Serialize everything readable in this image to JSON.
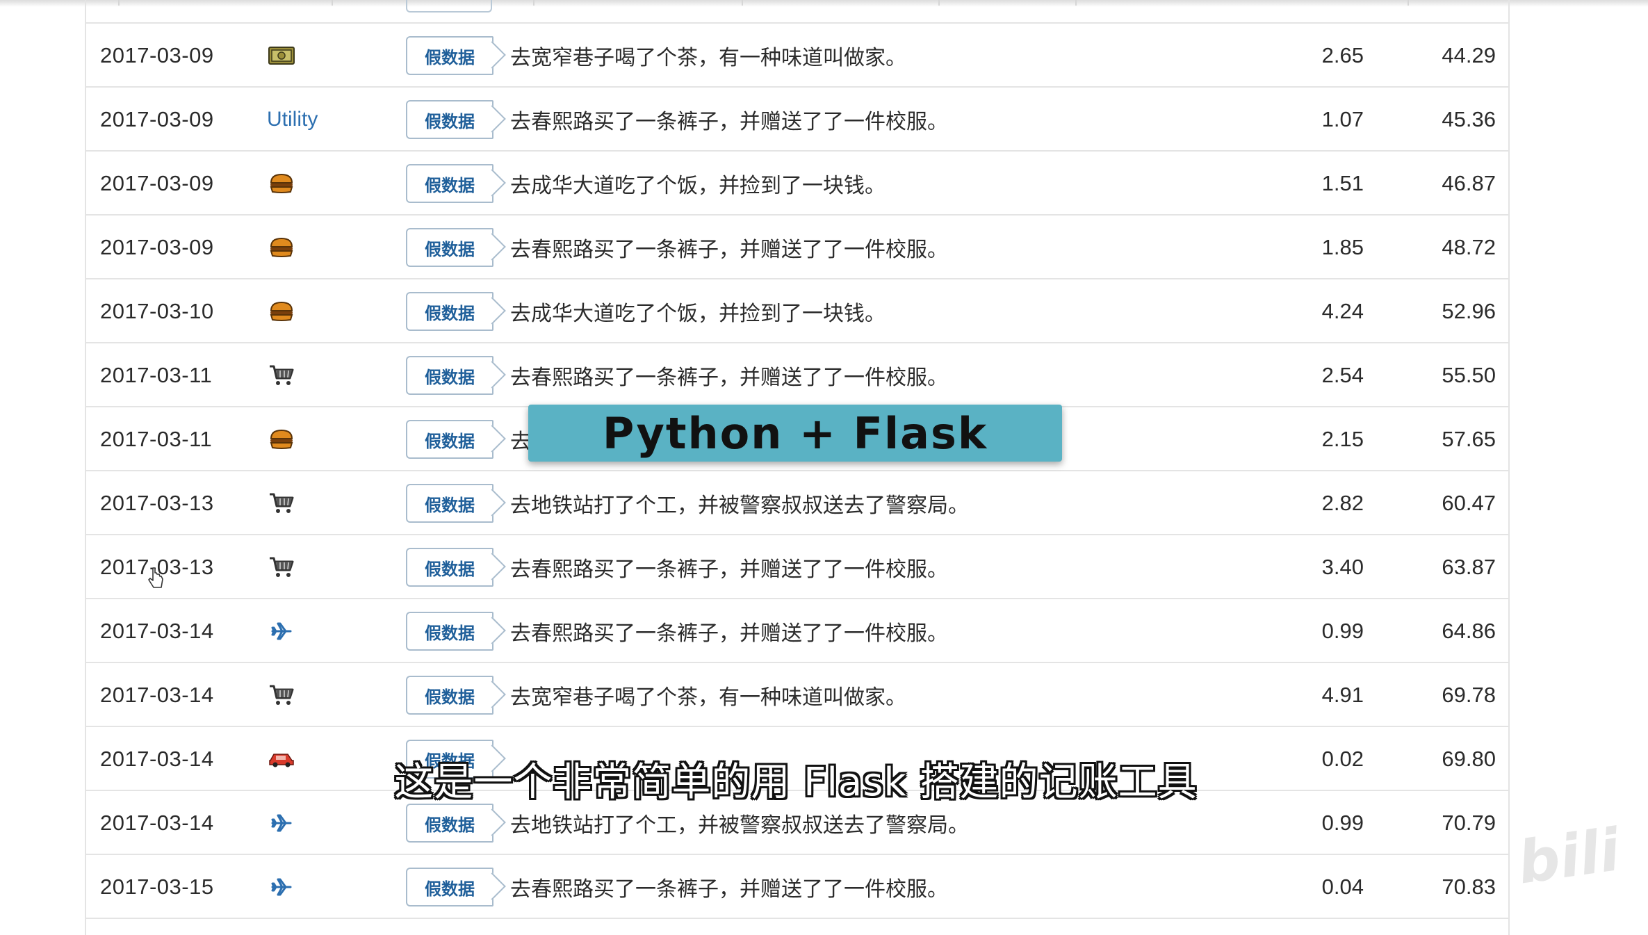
{
  "tag_label": "假数据",
  "rows": [
    {
      "date": "2017-03-09",
      "category": {
        "type": "icon",
        "icon": "money-icon"
      },
      "desc": "去宽窄巷子喝了个茶，有一种味道叫做家。",
      "amount": "2.65",
      "balance": "44.29"
    },
    {
      "date": "2017-03-09",
      "category": {
        "type": "text",
        "text": "Utility"
      },
      "desc": "去春熙路买了一条裤子，并赠送了了一件校服。",
      "amount": "1.07",
      "balance": "45.36"
    },
    {
      "date": "2017-03-09",
      "category": {
        "type": "icon",
        "icon": "burger-icon"
      },
      "desc": "去成华大道吃了个饭，并捡到了一块钱。",
      "amount": "1.51",
      "balance": "46.87"
    },
    {
      "date": "2017-03-09",
      "category": {
        "type": "icon",
        "icon": "burger-icon"
      },
      "desc": "去春熙路买了一条裤子，并赠送了了一件校服。",
      "amount": "1.85",
      "balance": "48.72"
    },
    {
      "date": "2017-03-10",
      "category": {
        "type": "icon",
        "icon": "burger-icon"
      },
      "desc": "去成华大道吃了个饭，并捡到了一块钱。",
      "amount": "4.24",
      "balance": "52.96"
    },
    {
      "date": "2017-03-11",
      "category": {
        "type": "icon",
        "icon": "shopping-cart-icon"
      },
      "desc": "去春熙路买了一条裤子，并赠送了了一件校服。",
      "amount": "2.54",
      "balance": "55.50"
    },
    {
      "date": "2017-03-11",
      "category": {
        "type": "icon",
        "icon": "burger-icon"
      },
      "desc": "去",
      "amount": "2.15",
      "balance": "57.65"
    },
    {
      "date": "2017-03-13",
      "category": {
        "type": "icon",
        "icon": "shopping-cart-icon"
      },
      "desc": "去地铁站打了个工，并被警察叔叔送去了警察局。",
      "amount": "2.82",
      "balance": "60.47"
    },
    {
      "date": "2017-03-13",
      "category": {
        "type": "icon",
        "icon": "shopping-cart-icon"
      },
      "desc": "去春熙路买了一条裤子，并赠送了了一件校服。",
      "amount": "3.40",
      "balance": "63.87"
    },
    {
      "date": "2017-03-14",
      "category": {
        "type": "icon",
        "icon": "airplane-icon"
      },
      "desc": "去春熙路买了一条裤子，并赠送了了一件校服。",
      "amount": "0.99",
      "balance": "64.86"
    },
    {
      "date": "2017-03-14",
      "category": {
        "type": "icon",
        "icon": "shopping-cart-icon"
      },
      "desc": "去宽窄巷子喝了个茶，有一种味道叫做家。",
      "amount": "4.91",
      "balance": "69.78"
    },
    {
      "date": "2017-03-14",
      "category": {
        "type": "icon",
        "icon": "car-icon"
      },
      "desc": "",
      "amount": "0.02",
      "balance": "69.80"
    },
    {
      "date": "2017-03-14",
      "category": {
        "type": "icon",
        "icon": "airplane-icon"
      },
      "desc": "去地铁站打了个工，并被警察叔叔送去了警察局。",
      "amount": "0.99",
      "balance": "70.79"
    },
    {
      "date": "2017-03-15",
      "category": {
        "type": "icon",
        "icon": "airplane-icon"
      },
      "desc": "去春熙路买了一条裤子，并赠送了了一件校服。",
      "amount": "0.04",
      "balance": "70.83"
    }
  ],
  "overlay_title": "Python + Flask",
  "subtitle": "这是一个非常简单的用 Flask 搭建的记账工具",
  "colors": {
    "accent": "#1f5f9a",
    "overlay_bg": "#5ab2c4",
    "burger": "#e08a1e",
    "car": "#d93a2b",
    "plane": "#2c6fb0"
  }
}
